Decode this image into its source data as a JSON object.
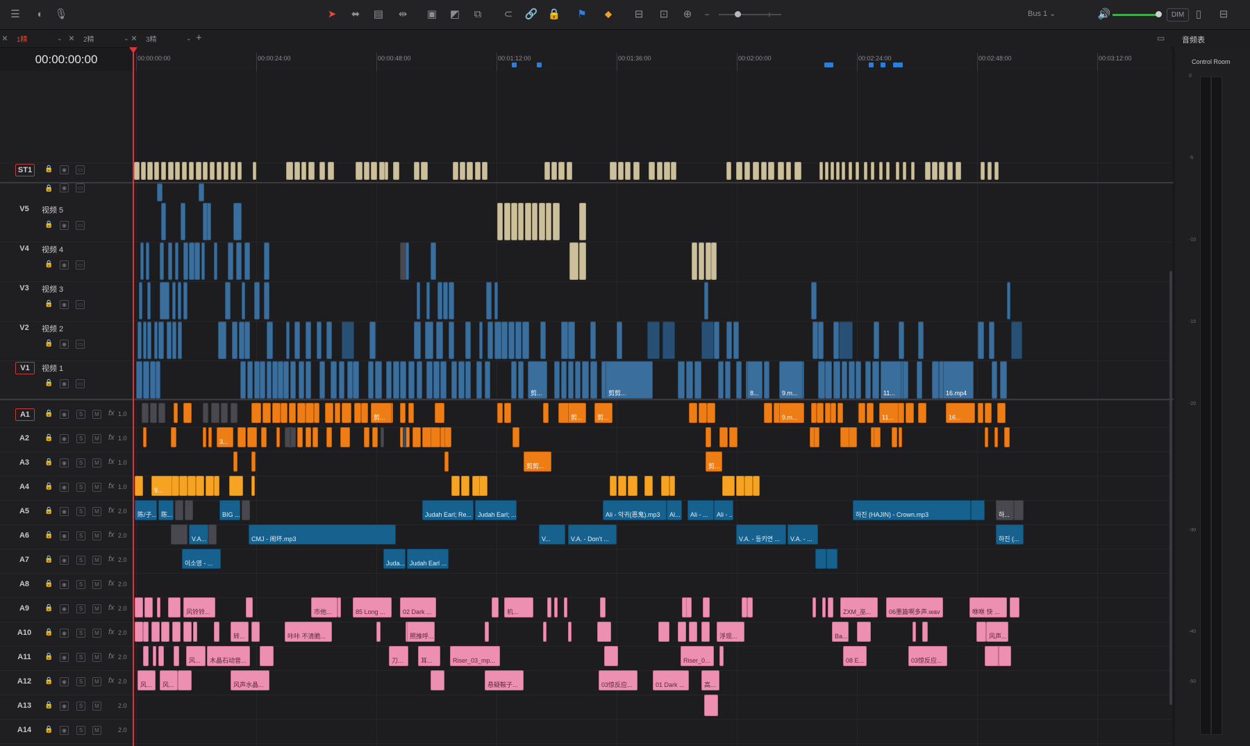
{
  "toolbar": {
    "bus_label": "Bus 1 ⌄",
    "dim_label": "DIM"
  },
  "tabs": [
    {
      "label": "1精",
      "active": true
    },
    {
      "label": "2精",
      "active": false
    },
    {
      "label": "3精",
      "active": false
    }
  ],
  "meters": {
    "title": "音频表",
    "control_room": "Control Room",
    "scale": [
      "0",
      "-5",
      "-10",
      "-15",
      "-20",
      "-30",
      "-40",
      "-50"
    ]
  },
  "timecode": "00:00:00:00",
  "ruler": [
    "00:00:00:00",
    "00:00:24:00",
    "00:00:48:00",
    "00:01:12:00",
    "00:01:36:00",
    "00:02:00:00",
    "00:02:24:00",
    "00:02:48:00",
    "00:03:12:00"
  ],
  "tracks": {
    "subtitle": {
      "id": "ST1"
    },
    "video": [
      {
        "id": "V5",
        "name": "视频 5"
      },
      {
        "id": "V4",
        "name": "视频 4"
      },
      {
        "id": "V3",
        "name": "视频 3"
      },
      {
        "id": "V2",
        "name": "视频 2"
      },
      {
        "id": "V1",
        "name": "视频 1"
      }
    ],
    "audio": [
      {
        "id": "A1",
        "fx": "1.0"
      },
      {
        "id": "A2",
        "fx": "1.0"
      },
      {
        "id": "A3",
        "fx": "1.0"
      },
      {
        "id": "A4",
        "fx": "1.0"
      },
      {
        "id": "A5",
        "fx": "2.0"
      },
      {
        "id": "A6",
        "fx": "2.0"
      },
      {
        "id": "A7",
        "fx": "2.0"
      },
      {
        "id": "A8",
        "fx": "2.0"
      },
      {
        "id": "A9",
        "fx": "2.0"
      },
      {
        "id": "A10",
        "fx": "2.0"
      },
      {
        "id": "A11",
        "fx": "2.0"
      },
      {
        "id": "A12",
        "fx": "2.0"
      },
      {
        "id": "A13",
        "fx": "2.0"
      },
      {
        "id": "A14",
        "fx": "2.0"
      }
    ]
  },
  "clip_labels": {
    "v1_a": "剪...",
    "v1_b": "剪剪...",
    "v1_c": "8...",
    "v1_d": "9.m...",
    "v1_e": "11...",
    "v1_f": "16.mp4",
    "a1_a": "剪...",
    "a1_b": "剪...",
    "a1_c": "剪...",
    "a1_d": "9.m...",
    "a1_e": "11...",
    "a1_f": "16...",
    "a2_a": "3...",
    "a3_a": "剪剪...",
    "a3_b": "剪...",
    "a4_a": "9...",
    "a5_a": "陈/子...",
    "a5_b": "陈...",
    "a5_c": "BIG ...",
    "a5_d": "Judah Earl; Re...",
    "a5_e": "Judah Earl; ...",
    "a5_f": "Ali - 악귀(恶鬼).mp3",
    "a5_g": "Al...",
    "a5_h": "Ali - ...",
    "a5_i": "Ali - ...",
    "a5_j": "하진 (HAJIN) - Crown.mp3",
    "a5_k": "하...",
    "a6_a": "V.A...",
    "a6_b": "CMJ - 闹坏.mp3",
    "a6_c": "V...",
    "a6_d": "V.A. - Don't ...",
    "a6_e": "V.A. - 등키연 ...",
    "a6_f": "V.A. - ...",
    "a6_g": "하진 (...",
    "a7_a": "이소영 - ...",
    "a7_b": "Juda...",
    "a7_c": "Judah Earl ...",
    "a9_a": "风铃铃...",
    "a9_b": "市他...",
    "a9_c": "85 Long ...",
    "a9_d": "02 Dark ...",
    "a9_e": "机...",
    "a9_f": "ZXM_巫...",
    "a9_g": "06墨篇啊多声.wav",
    "a9_h": "咻咻 快 ...",
    "a10_a": "转...",
    "a10_b": "咔咔 不清脆...",
    "a10_c": "照推呼...",
    "a10_d": "浮现...",
    "a10_e": "Ba...",
    "a10_f": "风声...",
    "a11_a": "风...",
    "a11_b": "木晶石动音...",
    "a11_c": "刀...",
    "a11_d": "耳...",
    "a11_e": "Riser_03_mp...",
    "a11_f": "Riser_0...",
    "a11_g": "08 E...",
    "a11_h": "03惊反应...",
    "a12_a": "风...",
    "a12_b": "风...",
    "a12_c": "风声水晶...",
    "a12_d": "悬疑鞍子...",
    "a12_e": "03惊反应...",
    "a12_f": "01 Dark ...",
    "a12_g": "高..."
  },
  "colors": {
    "video": "#3a6e9c",
    "title": "#cbbf9c",
    "audio_orange": "#ef7d16",
    "audio_teal": "#17618e",
    "audio_pink": "#ec8fb0",
    "playhead": "#e0303a"
  }
}
